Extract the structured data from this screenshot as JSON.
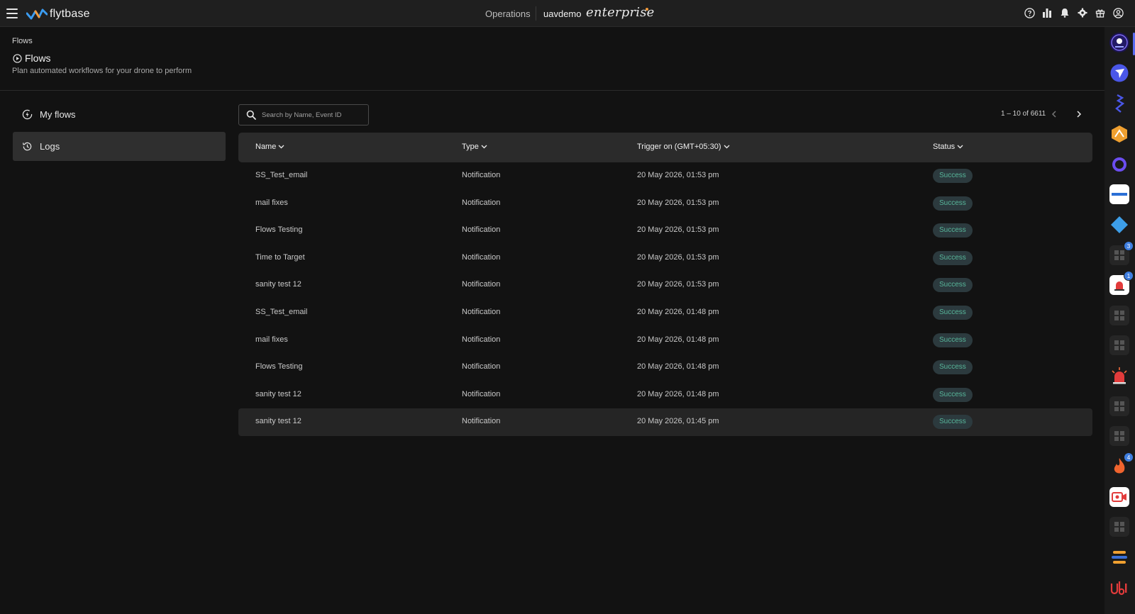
{
  "app": {
    "brand": "flytbase",
    "section": "Operations",
    "org": "uavdemo",
    "plan": "enterprise"
  },
  "breadcrumb": "Flows",
  "page": {
    "title": "Flows",
    "subtitle": "Plan automated workflows for your drone to perform"
  },
  "nav": {
    "my_flows": "My flows",
    "logs": "Logs"
  },
  "search": {
    "placeholder": "Search by Name, Event ID"
  },
  "pager": {
    "range": "1 – 10 of 6611"
  },
  "table": {
    "headers": {
      "name": "Name",
      "type": "Type",
      "trigger": "Trigger on (GMT+05:30)",
      "status": "Status"
    },
    "rows": [
      {
        "name": "SS_Test_email",
        "type": "Notification",
        "trigger": "20 May 2026, 01:53 pm",
        "status": "Success"
      },
      {
        "name": "mail fixes",
        "type": "Notification",
        "trigger": "20 May 2026, 01:53 pm",
        "status": "Success"
      },
      {
        "name": "Flows Testing",
        "type": "Notification",
        "trigger": "20 May 2026, 01:53 pm",
        "status": "Success"
      },
      {
        "name": "Time to Target",
        "type": "Notification",
        "trigger": "20 May 2026, 01:53 pm",
        "status": "Success"
      },
      {
        "name": "sanity test 12",
        "type": "Notification",
        "trigger": "20 May 2026, 01:53 pm",
        "status": "Success"
      },
      {
        "name": "SS_Test_email",
        "type": "Notification",
        "trigger": "20 May 2026, 01:48 pm",
        "status": "Success"
      },
      {
        "name": "mail fixes",
        "type": "Notification",
        "trigger": "20 May 2026, 01:48 pm",
        "status": "Success"
      },
      {
        "name": "Flows Testing",
        "type": "Notification",
        "trigger": "20 May 2026, 01:48 pm",
        "status": "Success"
      },
      {
        "name": "sanity test 12",
        "type": "Notification",
        "trigger": "20 May 2026, 01:48 pm",
        "status": "Success"
      },
      {
        "name": "sanity test 12",
        "type": "Notification",
        "trigger": "20 May 2026, 01:45 pm",
        "status": "Success"
      }
    ]
  },
  "rail": {
    "badges": {
      "b1": "3",
      "b2": "1",
      "b3": "4"
    },
    "items": [
      "drone-app-icon",
      "send-app-icon",
      "lightning-app-icon",
      "orange-hex-app-icon",
      "ring-app-icon",
      "genetec-app-icon",
      "diamond-app-icon",
      "grid-app-icon",
      "alarm-app-icon",
      "grid-app-icon",
      "grid-app-icon",
      "siren-app-icon",
      "grid-app-icon",
      "grid-app-icon",
      "fire-app-icon",
      "video-app-icon",
      "grid-app-icon",
      "stripes-app-icon",
      "ubi-app-icon"
    ]
  },
  "colors": {
    "success_text": "#58b79b",
    "success_bg": "#2c3a3e",
    "accent": "#5a6cf0"
  }
}
